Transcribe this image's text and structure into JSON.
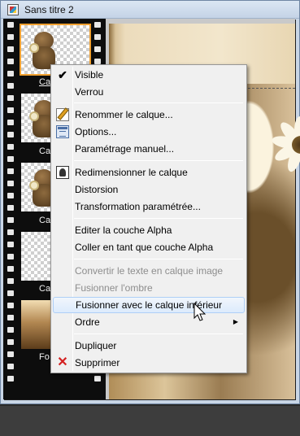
{
  "window": {
    "title": "Sans titre 2"
  },
  "layers": [
    {
      "label": "Calque",
      "visible_label": "Cal",
      "selected": true
    },
    {
      "label": "Calque",
      "visible_label": "Cal",
      "selected": false
    },
    {
      "label": "Calque",
      "visible_label": "Cal",
      "selected": false
    },
    {
      "label": "Calque",
      "visible_label": "Cal",
      "selected": false
    },
    {
      "label": "Fond",
      "visible_label": "Fo",
      "selected": false
    }
  ],
  "context_menu": {
    "items": [
      {
        "label": "Visible",
        "checked": true,
        "icon": "check-icon"
      },
      {
        "label": "Verrou"
      },
      {
        "label": "Renommer le calque...",
        "icon": "rename-icon"
      },
      {
        "label": "Options...",
        "icon": "options-icon"
      },
      {
        "label": "Paramétrage manuel..."
      },
      {
        "label": "Redimensionner le calque",
        "icon": "resize-icon"
      },
      {
        "label": "Distorsion"
      },
      {
        "label": "Transformation paramétrée..."
      },
      {
        "label": "Editer la couche Alpha"
      },
      {
        "label": "Coller en tant que couche Alpha"
      },
      {
        "label": "Convertir le texte en calque image",
        "disabled": true
      },
      {
        "label": "Fusionner l'ombre",
        "disabled": true
      },
      {
        "label": "Fusionner avec le calque inférieur",
        "highlighted": true
      },
      {
        "label": "Ordre",
        "submenu": true
      },
      {
        "label": "Dupliquer"
      },
      {
        "label": "Supprimer",
        "icon": "delete-icon"
      }
    ]
  },
  "colors": {
    "menu_background": "#f0f0f0",
    "highlight_border": "#aecff7",
    "disabled_text": "#8d8d8d",
    "selection_outline": "#f0a030"
  }
}
